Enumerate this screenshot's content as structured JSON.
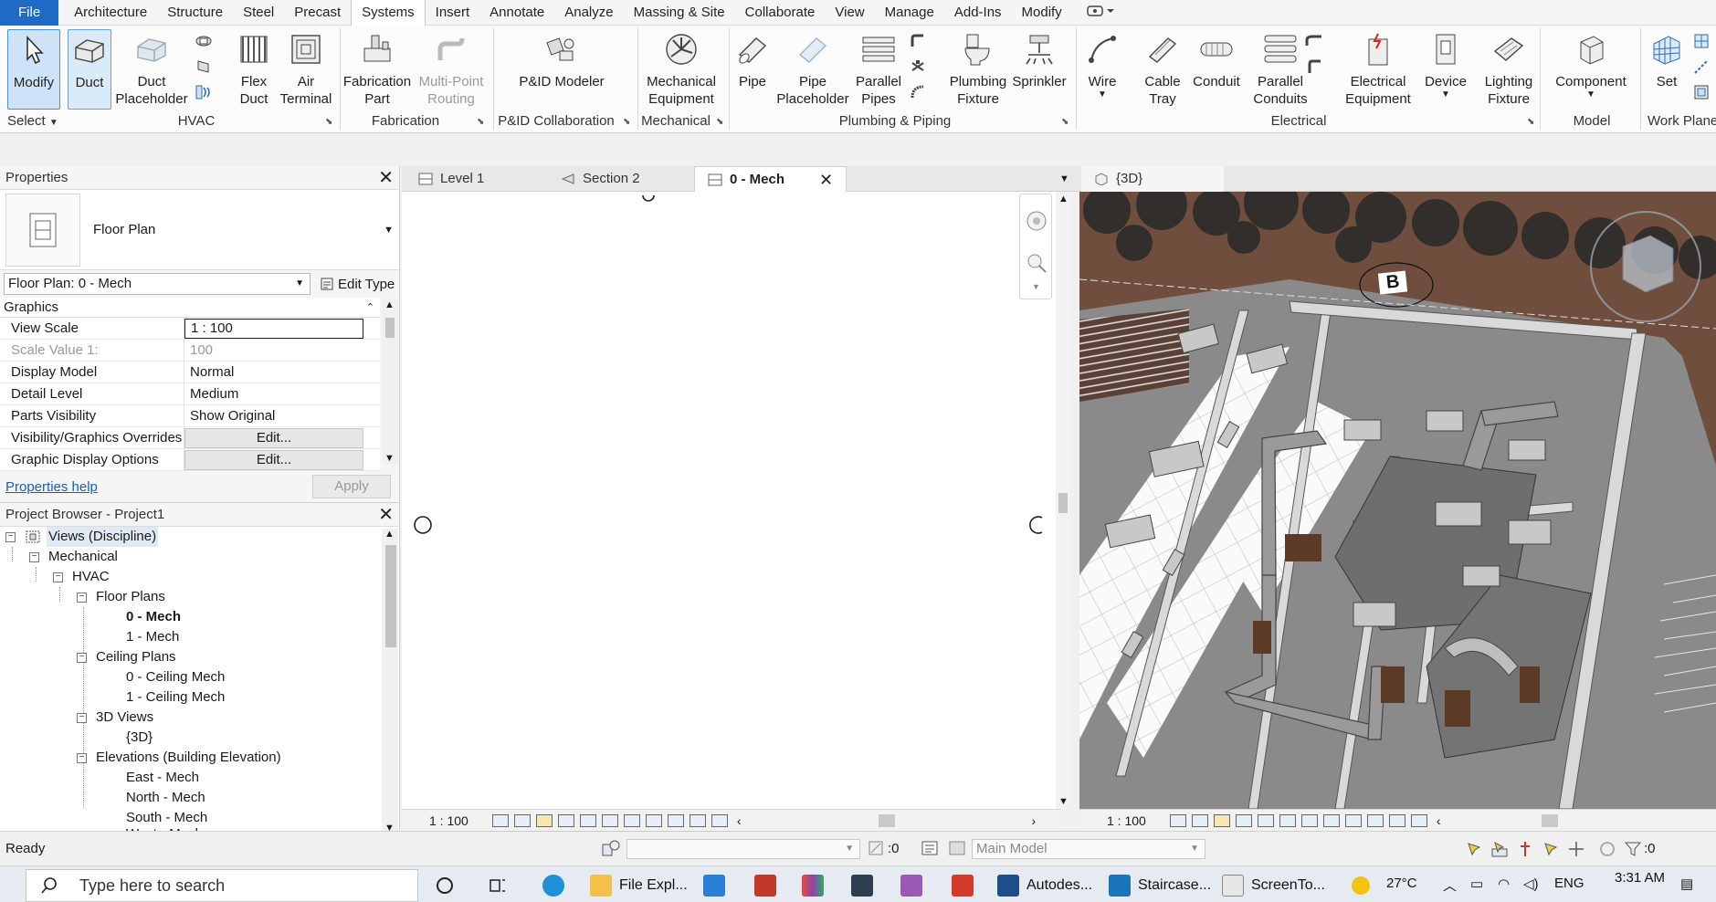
{
  "menubar": {
    "tabs": [
      "File",
      "Architecture",
      "Structure",
      "Steel",
      "Precast",
      "Systems",
      "Insert",
      "Annotate",
      "Analyze",
      "Massing & Site",
      "Collaborate",
      "View",
      "Manage",
      "Add-Ins",
      "Modify"
    ],
    "active": "Systems"
  },
  "ribbon": {
    "buttons": {
      "modify": "Modify",
      "duct": "Duct",
      "duct_placeholder": [
        "Duct",
        "Placeholder"
      ],
      "flex_duct": [
        "Flex",
        "Duct"
      ],
      "air_terminal": [
        "Air",
        "Terminal"
      ],
      "fabrication_part": [
        "Fabrication",
        "Part"
      ],
      "multi_point_routing": [
        "Multi-Point",
        "Routing"
      ],
      "pid_modeler": "P&ID Modeler",
      "mechanical_equipment": [
        "Mechanical",
        "Equipment"
      ],
      "pipe": "Pipe",
      "pipe_placeholder": [
        "Pipe",
        "Placeholder"
      ],
      "parallel_pipes": [
        "Parallel",
        "Pipes"
      ],
      "plumbing_fixture": [
        "Plumbing",
        "Fixture"
      ],
      "sprinkler": "Sprinkler",
      "wire": "Wire",
      "cable_tray": [
        "Cable",
        "Tray"
      ],
      "conduit": "Conduit",
      "parallel_conduits": [
        "Parallel",
        "Conduits"
      ],
      "electrical_equipment": [
        "Electrical",
        "Equipment"
      ],
      "device": "Device",
      "lighting_fixture": [
        "Lighting",
        "Fixture"
      ],
      "component": "Component",
      "set": "Set"
    },
    "panels": {
      "select": "Select",
      "hvac": "HVAC",
      "fabrication": "Fabrication",
      "pid": "P&ID Collaboration",
      "mechanical": "Mechanical",
      "plumbing": "Plumbing & Piping",
      "electrical": "Electrical",
      "model": "Model",
      "workplane": "Work Plane"
    }
  },
  "properties": {
    "title": "Properties",
    "type_name": "Floor Plan",
    "instance": "Floor Plan: 0 - Mech",
    "edit_type": "Edit Type",
    "group": "Graphics",
    "rows": [
      {
        "key": "View Scale",
        "value": "1 : 100"
      },
      {
        "key": "Scale Value    1:",
        "value": "100"
      },
      {
        "key": "Display Model",
        "value": "Normal"
      },
      {
        "key": "Detail Level",
        "value": "Medium"
      },
      {
        "key": "Parts Visibility",
        "value": "Show Original"
      },
      {
        "key": "Visibility/Graphics Overrides",
        "value": "Edit..."
      },
      {
        "key": "Graphic Display Options",
        "value": "Edit..."
      }
    ],
    "help": "Properties help",
    "apply": "Apply"
  },
  "browser": {
    "title": "Project Browser - Project1",
    "items": [
      "Views (Discipline)",
      "Mechanical",
      "HVAC",
      "Floor Plans",
      "0 - Mech",
      "1 - Mech",
      "Ceiling Plans",
      "0 - Ceiling Mech",
      "1 - Ceiling Mech",
      "3D Views",
      "{3D}",
      "Elevations (Building Elevation)",
      "East - Mech",
      "North - Mech",
      "South - Mech",
      "West - Mech"
    ]
  },
  "view_tabs": {
    "tab1": "Level 1",
    "tab2": "Section 2",
    "tab3": "0 - Mech",
    "tab4": "{3D}"
  },
  "view3d": {
    "label_b": "B"
  },
  "viewbars": {
    "scale_2d": "1 : 100",
    "scale_3d": "1 : 100"
  },
  "statusbar": {
    "status": "Ready",
    "selection_count": ":0",
    "model": "Main Model",
    "filter_count": ":0"
  },
  "taskbar": {
    "search_placeholder": "Type here to search",
    "apps": [
      "File Expl...",
      "Autodes...",
      "Staircase...",
      "ScreenTo..."
    ],
    "temperature": "27°C",
    "lang": "ENG",
    "time": "3:31 AM"
  },
  "colors": {
    "file_tab": "#1e6ac4",
    "selection": "#cfe3f8",
    "link": "#1a5fb4",
    "floor_wood": "#6b4a3a"
  }
}
